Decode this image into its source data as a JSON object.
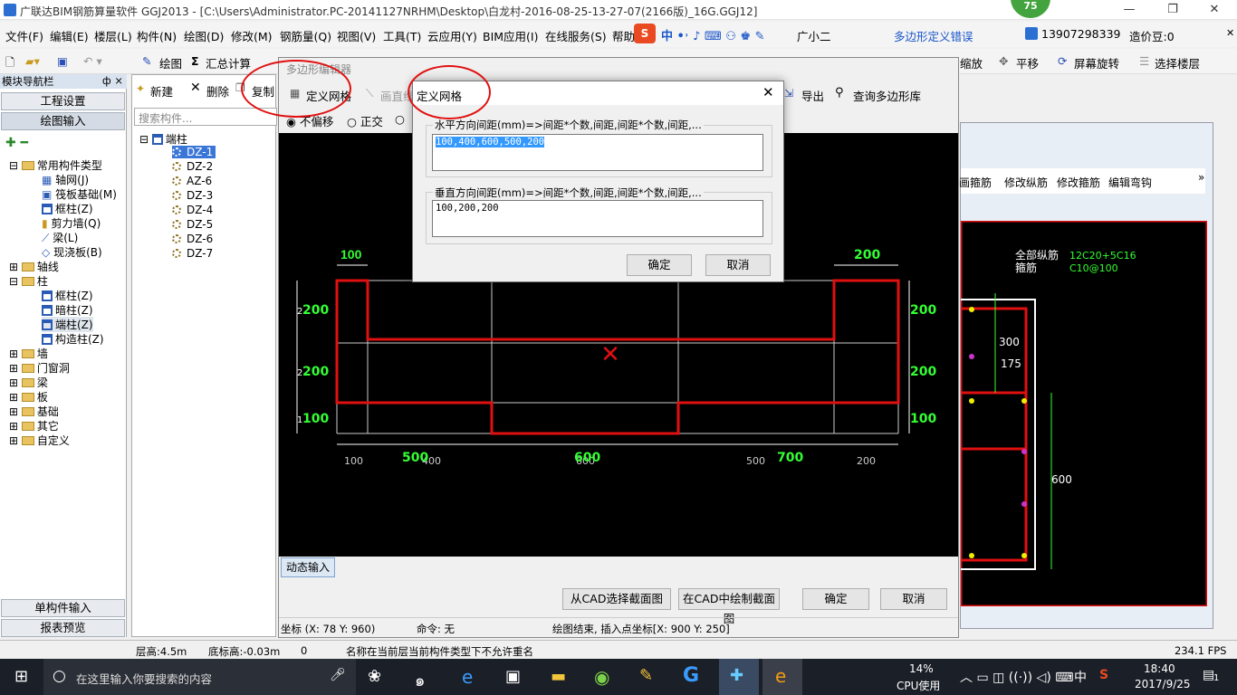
{
  "window": {
    "title": "广联达BIM钢筋算量软件 GGJ2013 - [C:\\Users\\Administrator.PC-20141127NRHM\\Desktop\\白龙村-2016-08-25-13-27-07(2166版)_16G.GGJ12]",
    "badge": "75"
  },
  "menu": [
    "文件(F)",
    "编辑(E)",
    "楼层(L)",
    "构件(N)",
    "绘图(D)",
    "修改(M)",
    "钢筋量(Q)",
    "视图(V)",
    "工具(T)",
    "云应用(Y)",
    "BIM应用(I)",
    "在线服务(S)",
    "帮助"
  ],
  "menu_right": {
    "ime_user": "广小二",
    "error_label": "多边形定义错误",
    "phone": "13907298339",
    "price": "造价豆:0"
  },
  "toolbar": {
    "draw": "绘图",
    "sum": "汇总计算",
    "zoom": "缩放",
    "pan": "平移",
    "rotate": "屏幕旋转",
    "select_floor": "选择楼层"
  },
  "nav": {
    "header": "模块导航栏",
    "pin": "ф ×",
    "eng_setup": "工程设置",
    "draw_input": "绘图输入",
    "single_input": "单构件输入",
    "report": "报表预览",
    "tree": [
      "常用构件类型",
      "轴网(J)",
      "筏板基础(M)",
      "框柱(Z)",
      "剪力墙(Q)",
      "梁(L)",
      "现浇板(B)",
      "轴线",
      "柱",
      "框柱(Z)",
      "暗柱(Z)",
      "端柱(Z)",
      "构造柱(Z)",
      "墙",
      "门窗洞",
      "梁",
      "板",
      "基础",
      "其它",
      "自定义"
    ]
  },
  "mid": {
    "new": "新建",
    "delete": "删除",
    "copy": "复制",
    "search_placeholder": "搜索构件...",
    "root": "端柱",
    "items": [
      "DZ-1",
      "DZ-2",
      "AZ-6",
      "DZ-3",
      "DZ-4",
      "DZ-5",
      "DZ-6",
      "DZ-7"
    ]
  },
  "poly_editor": {
    "title": "多边形编辑器",
    "define_grid": "定义网格",
    "draw_line": "画直线",
    "export": "导出",
    "query_lib": "查询多边形库",
    "no_offset": "不偏移",
    "ortho": "正交",
    "dynamic_input": "动态输入",
    "cad_select": "从CAD选择截面图",
    "cad_draw": "在CAD中绘制截面图",
    "ok": "确定",
    "cancel": "取消",
    "coord": "坐标 (X: 78 Y: 960)",
    "command": "命令: 无",
    "prompt": "绘图结束, 插入点坐标[X: 900 Y: 250]"
  },
  "canvas_labels": {
    "top_left": "100",
    "top_right": "200",
    "left": [
      "200",
      "200",
      "100"
    ],
    "left_small": [
      "2",
      "2",
      "1"
    ],
    "right": [
      "200",
      "200",
      "100"
    ],
    "bottom_green": [
      "500",
      "600",
      "700"
    ],
    "bottom_white": [
      "100",
      "400",
      "600",
      "500",
      "200"
    ]
  },
  "dialog": {
    "title": "定义网格",
    "h_label": "水平方向间距(mm)=>间距*个数,间距,间距*个数,间距,...",
    "h_value": "100,400,600,500,200",
    "v_label": "垂直方向间距(mm)=>间距*个数,间距,间距*个数,间距,...",
    "v_value": "100,200,200",
    "ok": "确定",
    "cancel": "取消"
  },
  "right_panel": {
    "tabs": [
      "画箍筋",
      "修改纵筋",
      "修改箍筋",
      "编辑弯钩"
    ],
    "long_bar_label": "全部纵筋",
    "long_bar_value": "12C20+5C16",
    "stirrup_label": "箍筋",
    "stirrup_value": "C10@100",
    "dims": [
      "300",
      "175",
      "600"
    ]
  },
  "status": {
    "floor_h": "层高:4.5m",
    "bottom_h": "底标高:-0.03m",
    "num": "0",
    "msg": "名称在当前层当前构件类型下不允许重名",
    "fps": "234.1 FPS"
  },
  "taskbar": {
    "search": "在这里输入你要搜索的内容",
    "cpu_pct": "14%",
    "cpu_label": "CPU使用",
    "ime": "中",
    "time": "18:40",
    "date": "2017/9/25",
    "notif": "1"
  }
}
